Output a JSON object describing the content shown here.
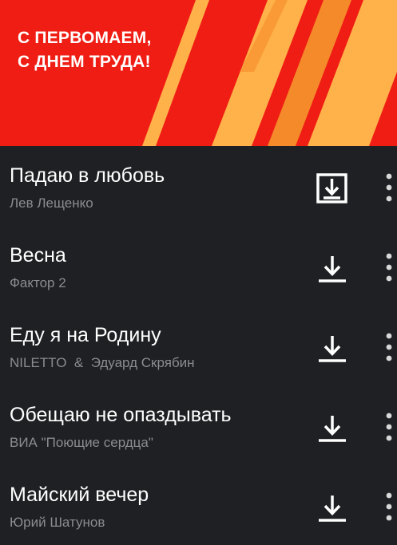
{
  "banner": {
    "line1": "С ПЕРВОМАЕМ,",
    "line2": "С ДНЕМ ТРУДА!",
    "colors": {
      "background": "#ef1d14",
      "stripes": "#ffb24a",
      "stripes_dark": "#f58a2a"
    }
  },
  "tracks": [
    {
      "title": "Падаю в любовь",
      "artist": "Лев Лещенко",
      "icon": "download-boxed-icon"
    },
    {
      "title": "Весна",
      "artist": "Фактор 2",
      "icon": "download-icon"
    },
    {
      "title": "Еду я на Родину",
      "artist": "NILETTO  &  Эдуард Скрябин",
      "icon": "download-icon"
    },
    {
      "title": "Обещаю не опаздывать",
      "artist": "ВИА \"Поющие сердца\"",
      "icon": "download-icon"
    },
    {
      "title": "Майский вечер",
      "artist": "Юрий Шатунов",
      "icon": "download-icon"
    }
  ]
}
